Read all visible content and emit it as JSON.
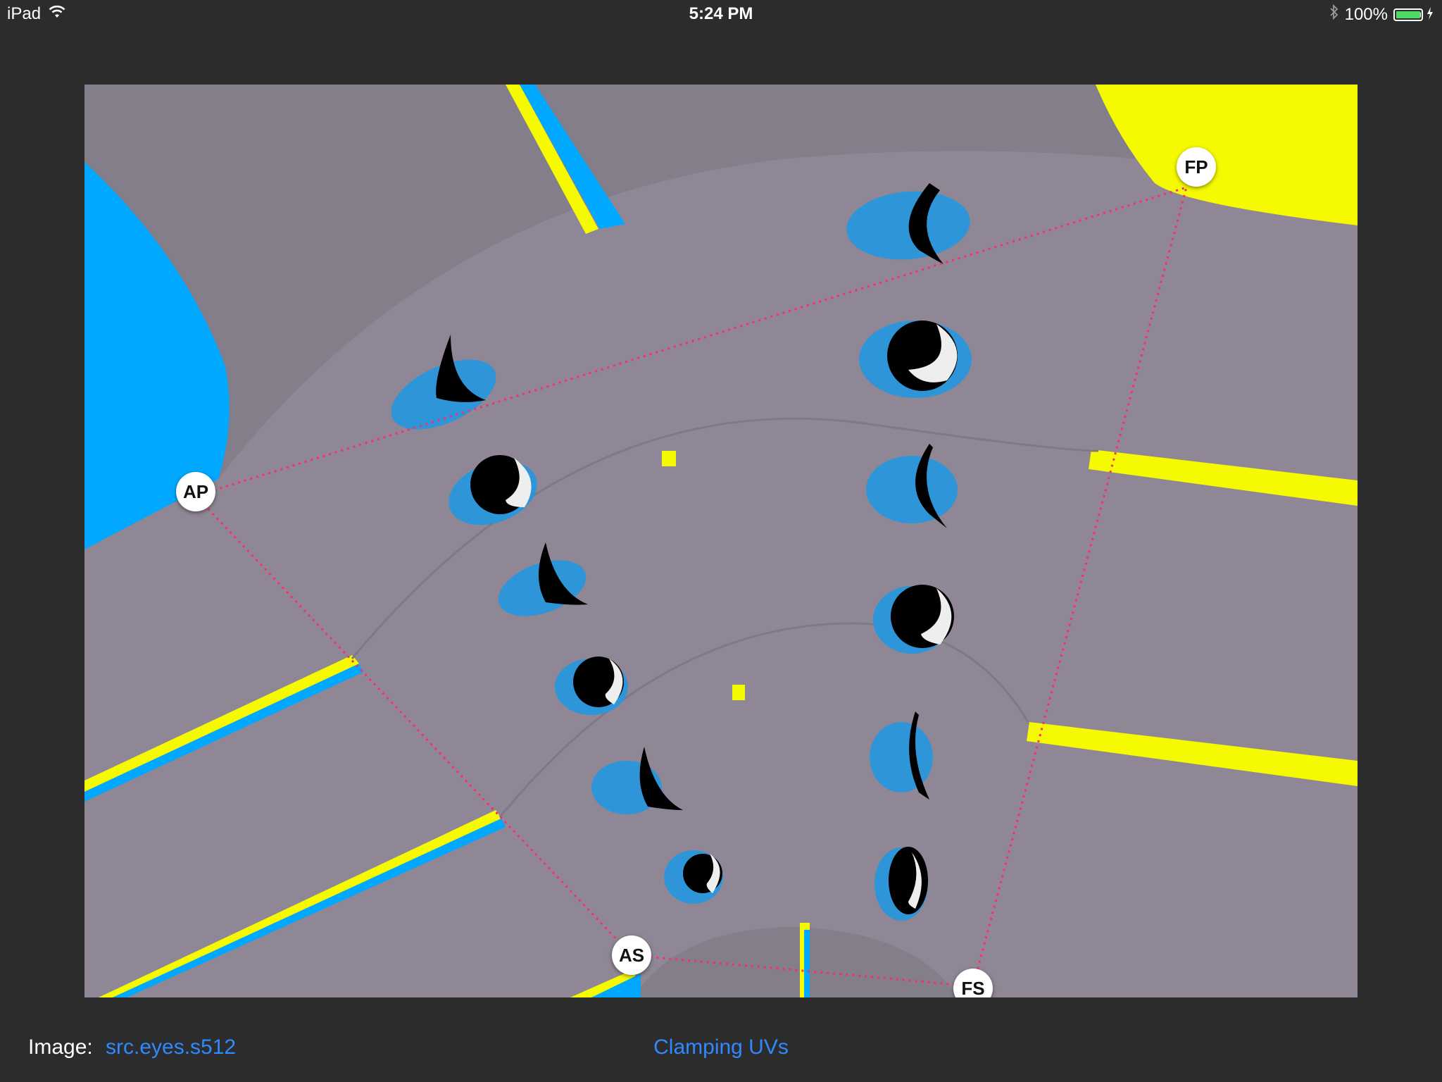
{
  "status_bar": {
    "device": "iPad",
    "time": "5:24 PM",
    "battery": "100%",
    "icons": [
      "wifi-icon",
      "bluetooth-icon",
      "battery-icon",
      "charging-bolt-icon"
    ]
  },
  "handles": {
    "ap": "AP",
    "fp": "FP",
    "as": "AS",
    "fs": "FS"
  },
  "footer": {
    "image_label": "Image:",
    "image_name": "src.eyes.s512",
    "mode_button": "Clamping UVs"
  },
  "colors": {
    "background": "#2c2c2c",
    "canvas_gray": "#8f8795",
    "dark_gray": "#847d8a",
    "blue": "#00a8ff",
    "yellow": "#f5fa00",
    "link": "#2f89ff",
    "guide_line": "#ff2a6e"
  }
}
